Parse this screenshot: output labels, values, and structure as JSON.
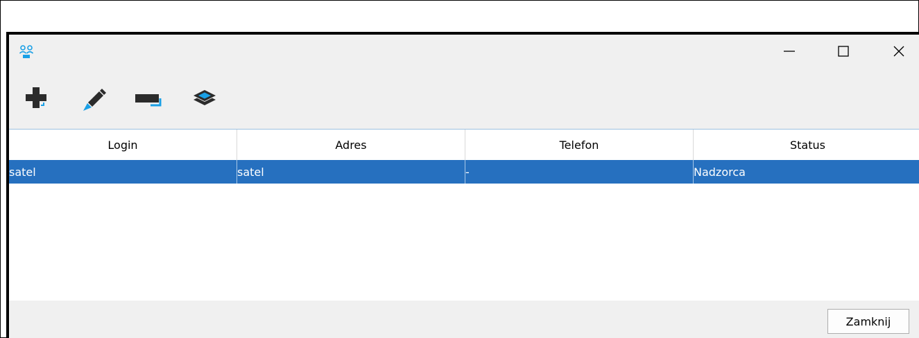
{
  "window": {
    "icon": "users-icon",
    "controls": {
      "minimize": "minimize-icon",
      "maximize": "maximize-icon",
      "close": "close-icon"
    }
  },
  "toolbar": {
    "buttons": [
      {
        "name": "add",
        "icon": "add-user-icon"
      },
      {
        "name": "edit",
        "icon": "pencil-icon"
      },
      {
        "name": "remove",
        "icon": "remove-icon"
      },
      {
        "name": "layers",
        "icon": "layers-icon"
      }
    ]
  },
  "table": {
    "columns": [
      "Login",
      "Adres",
      "Telefon",
      "Status"
    ],
    "rows": [
      {
        "login": "satel",
        "adres": "satel",
        "telefon": "-",
        "status": "Nadzorca",
        "selected": true
      }
    ]
  },
  "footer": {
    "close_label": "Zamknij"
  },
  "colors": {
    "accent": "#2670bf",
    "icon_blue": "#1aa0e6",
    "icon_dark": "#2b2b2b"
  }
}
